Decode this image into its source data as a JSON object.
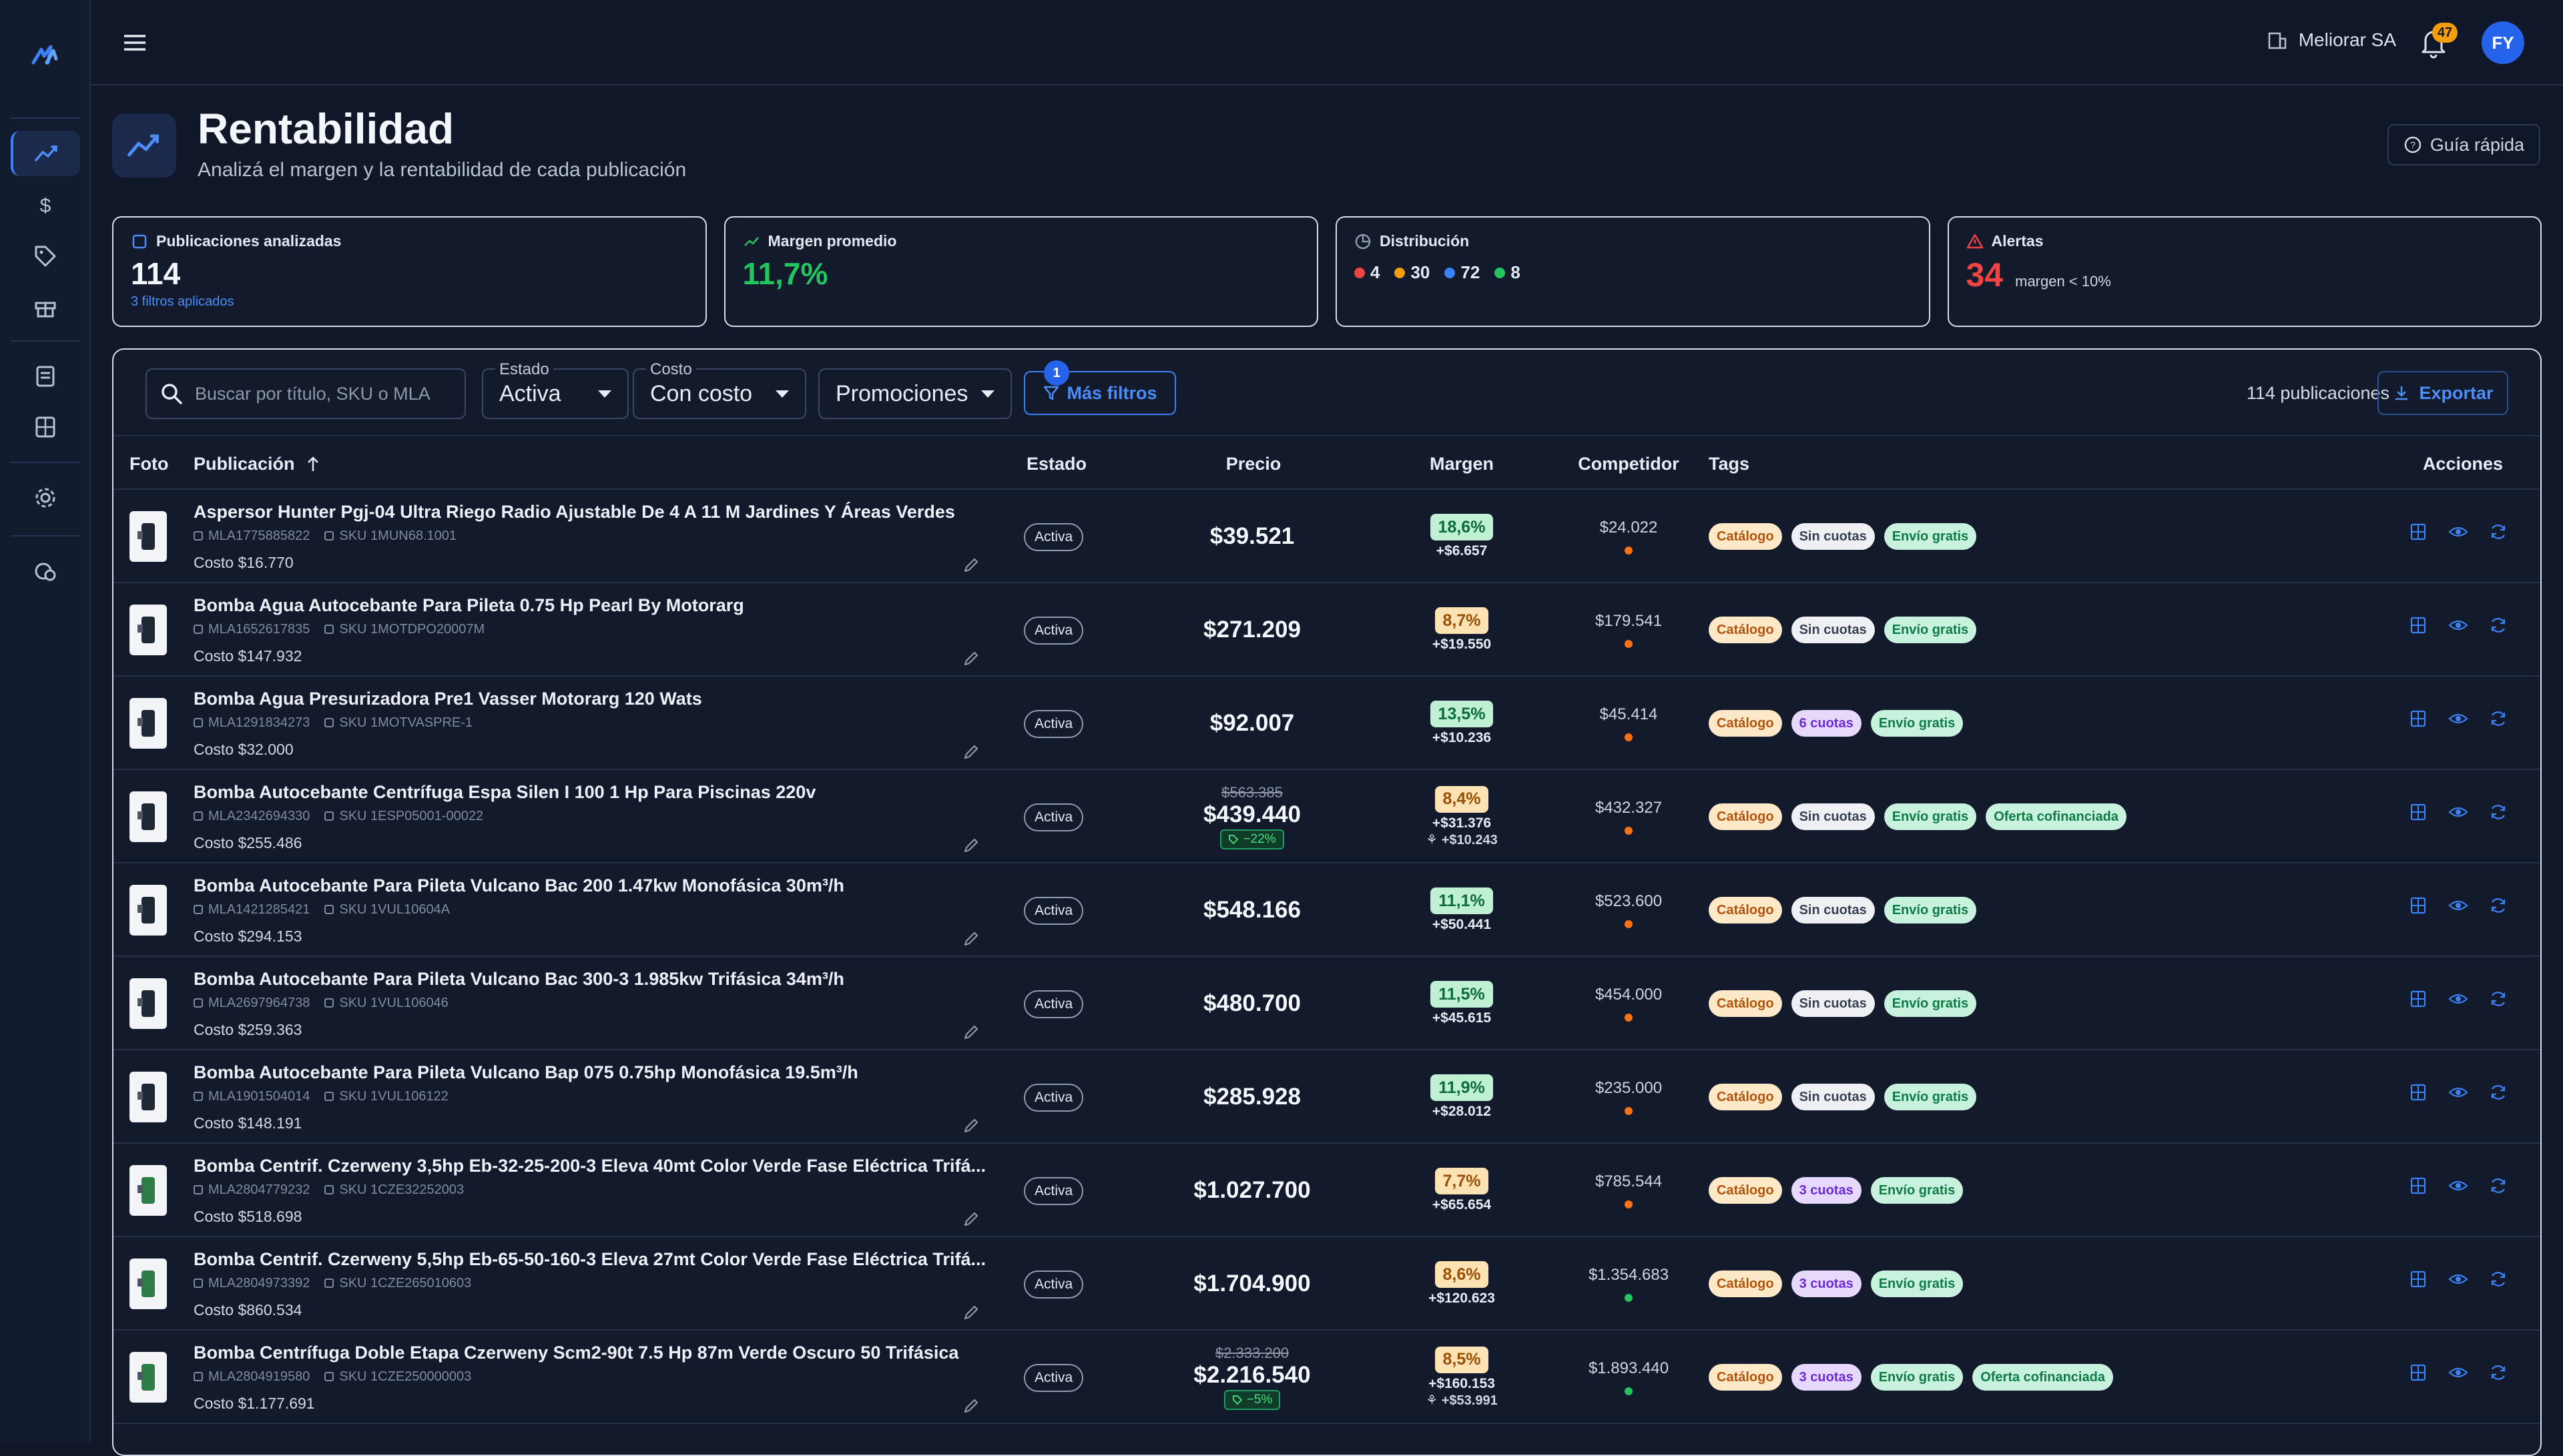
{
  "topbar": {
    "company": "Meliorar SA",
    "notifications": "47",
    "avatar_initials": "FY"
  },
  "page": {
    "title": "Rentabilidad",
    "subtitle": "Analizá el margen y la rentabilidad de cada publicación",
    "guide_label": "Guía rápida"
  },
  "cards": {
    "analyzed": {
      "label": "Publicaciones analizadas",
      "value": "114",
      "note": "3 filtros aplicados"
    },
    "margin": {
      "label": "Margen promedio",
      "value": "11,7%"
    },
    "distribution": {
      "label": "Distribución",
      "items": [
        {
          "value": "4",
          "color": "#ef4444"
        },
        {
          "value": "30",
          "color": "#f59e0b"
        },
        {
          "value": "72",
          "color": "#3b82f6"
        },
        {
          "value": "8",
          "color": "#22c55e"
        }
      ]
    },
    "alerts": {
      "label": "Alertas",
      "value": "34",
      "note": "margen < 10%"
    }
  },
  "filters": {
    "search_placeholder": "Buscar por título, SKU o MLA",
    "estado": {
      "legend": "Estado",
      "value": "Activa"
    },
    "costo": {
      "legend": "Costo",
      "value": "Con costo"
    },
    "promociones": {
      "value": "Promociones"
    },
    "more": {
      "label": "Más filtros",
      "badge": "1"
    },
    "count": "114 publicaciones",
    "export": "Exportar"
  },
  "columns": {
    "foto": "Foto",
    "publicacion": "Publicación",
    "estado": "Estado",
    "precio": "Precio",
    "margen": "Margen",
    "competidor": "Competidor",
    "tags": "Tags",
    "acciones": "Acciones"
  },
  "rows": [
    {
      "title": "Aspersor Hunter Pgj-04 Ultra Riego Radio Ajustable De 4 A 11 M Jardines Y Áreas Verdes",
      "mla": "MLA1775885822",
      "sku": "SKU 1MUN68.1001",
      "cost": "Costo $16.770",
      "estado": "Activa",
      "old_price": "",
      "price": "$39.521",
      "discount": "",
      "margin": "18,6%",
      "margin_type": "green",
      "margin_abs": "+$6.657",
      "margin_extra": "",
      "competitor": "$24.022",
      "comp_color": "#f97316",
      "tags": [
        "Catálogo",
        "Sin cuotas",
        "Envío gratis"
      ]
    },
    {
      "title": "Bomba Agua Autocebante Para Pileta 0.75 Hp Pearl By Motorarg",
      "mla": "MLA1652617835",
      "sku": "SKU 1MOTDPO20007M",
      "cost": "Costo $147.932",
      "estado": "Activa",
      "old_price": "",
      "price": "$271.209",
      "discount": "",
      "margin": "8,7%",
      "margin_type": "orange",
      "margin_abs": "+$19.550",
      "margin_extra": "",
      "competitor": "$179.541",
      "comp_color": "#f97316",
      "tags": [
        "Catálogo",
        "Sin cuotas",
        "Envío gratis"
      ]
    },
    {
      "title": "Bomba Agua Presurizadora Pre1 Vasser Motorarg 120 Wats",
      "mla": "MLA1291834273",
      "sku": "SKU 1MOTVASPRE-1",
      "cost": "Costo $32.000",
      "estado": "Activa",
      "old_price": "",
      "price": "$92.007",
      "discount": "",
      "margin": "13,5%",
      "margin_type": "green",
      "margin_abs": "+$10.236",
      "margin_extra": "",
      "competitor": "$45.414",
      "comp_color": "#f97316",
      "tags": [
        "Catálogo",
        "6 cuotas",
        "Envío gratis"
      ]
    },
    {
      "title": "Bomba Autocebante Centrífuga Espa Silen I 100 1 Hp Para Piscinas 220v",
      "mla": "MLA2342694330",
      "sku": "SKU 1ESP05001-00022",
      "cost": "Costo $255.486",
      "estado": "Activa",
      "old_price": "$563.385",
      "price": "$439.440",
      "discount": "−22%",
      "margin": "8,4%",
      "margin_type": "orange",
      "margin_abs": "+$31.376",
      "margin_extra": "+$10.243",
      "competitor": "$432.327",
      "comp_color": "#f97316",
      "tags": [
        "Catálogo",
        "Sin cuotas",
        "Envío gratis",
        "Oferta cofinanciada"
      ]
    },
    {
      "title": "Bomba Autocebante Para Pileta Vulcano Bac 200 1.47kw Monofásica 30m³/h",
      "mla": "MLA1421285421",
      "sku": "SKU 1VUL10604A",
      "cost": "Costo $294.153",
      "estado": "Activa",
      "old_price": "",
      "price": "$548.166",
      "discount": "",
      "margin": "11,1%",
      "margin_type": "green",
      "margin_abs": "+$50.441",
      "margin_extra": "",
      "competitor": "$523.600",
      "comp_color": "#f97316",
      "tags": [
        "Catálogo",
        "Sin cuotas",
        "Envío gratis"
      ]
    },
    {
      "title": "Bomba Autocebante Para Pileta Vulcano Bac 300-3 1.985kw Trifásica 34m³/h",
      "mla": "MLA2697964738",
      "sku": "SKU 1VUL106046",
      "cost": "Costo $259.363",
      "estado": "Activa",
      "old_price": "",
      "price": "$480.700",
      "discount": "",
      "margin": "11,5%",
      "margin_type": "green",
      "margin_abs": "+$45.615",
      "margin_extra": "",
      "competitor": "$454.000",
      "comp_color": "#f97316",
      "tags": [
        "Catálogo",
        "Sin cuotas",
        "Envío gratis"
      ]
    },
    {
      "title": "Bomba Autocebante Para Pileta Vulcano Bap 075 0.75hp Monofásica 19.5m³/h",
      "mla": "MLA1901504014",
      "sku": "SKU 1VUL106122",
      "cost": "Costo $148.191",
      "estado": "Activa",
      "old_price": "",
      "price": "$285.928",
      "discount": "",
      "margin": "11,9%",
      "margin_type": "green",
      "margin_abs": "+$28.012",
      "margin_extra": "",
      "competitor": "$235.000",
      "comp_color": "#f97316",
      "tags": [
        "Catálogo",
        "Sin cuotas",
        "Envío gratis"
      ]
    },
    {
      "title": "Bomba Centrif. Czerweny 3,5hp Eb-32-25-200-3 Eleva 40mt Color Verde Fase Eléctrica Trifá...",
      "mla": "MLA2804779232",
      "sku": "SKU 1CZE32252003",
      "cost": "Costo $518.698",
      "estado": "Activa",
      "old_price": "",
      "price": "$1.027.700",
      "discount": "",
      "margin": "7,7%",
      "margin_type": "orange",
      "margin_abs": "+$65.654",
      "margin_extra": "",
      "competitor": "$785.544",
      "comp_color": "#f97316",
      "tags": [
        "Catálogo",
        "3 cuotas",
        "Envío gratis"
      ]
    },
    {
      "title": "Bomba Centrif. Czerweny 5,5hp Eb-65-50-160-3 Eleva 27mt Color Verde Fase Eléctrica Trifá...",
      "mla": "MLA2804973392",
      "sku": "SKU 1CZE265010603",
      "cost": "Costo $860.534",
      "estado": "Activa",
      "old_price": "",
      "price": "$1.704.900",
      "discount": "",
      "margin": "8,6%",
      "margin_type": "orange",
      "margin_abs": "+$120.623",
      "margin_extra": "",
      "competitor": "$1.354.683",
      "comp_color": "#22c55e",
      "tags": [
        "Catálogo",
        "3 cuotas",
        "Envío gratis"
      ]
    },
    {
      "title": "Bomba Centrífuga Doble Etapa Czerweny Scm2-90t 7.5 Hp 87m Verde Oscuro 50 Trifásica",
      "mla": "MLA2804919580",
      "sku": "SKU 1CZE250000003",
      "cost": "Costo $1.177.691",
      "estado": "Activa",
      "old_price": "$2.333.200",
      "price": "$2.216.540",
      "discount": "−5%",
      "margin": "8,5%",
      "margin_type": "orange",
      "margin_abs": "+$160.153",
      "margin_extra": "+$53.991",
      "competitor": "$1.893.440",
      "comp_color": "#22c55e",
      "tags": [
        "Catálogo",
        "3 cuotas",
        "Envío gratis",
        "Oferta cofinanciada"
      ]
    }
  ]
}
